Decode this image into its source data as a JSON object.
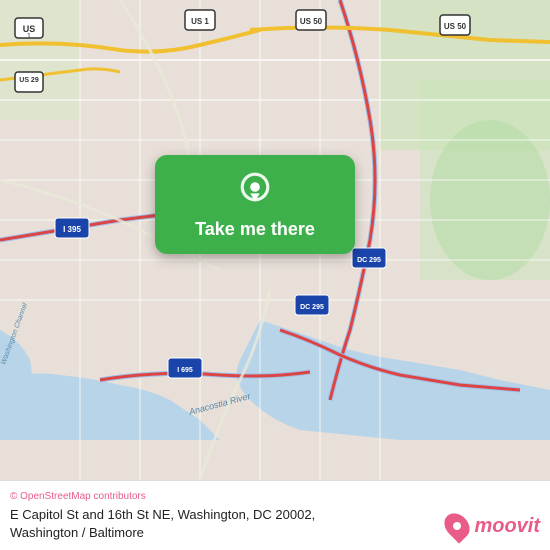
{
  "map": {
    "background_color": "#e8e0d8",
    "popup": {
      "label": "Take me there",
      "background": "#3db04b"
    }
  },
  "footer": {
    "osm_credit": "© OpenStreetMap contributors",
    "location_line1": "E Capitol St and 16th St NE, Washington, DC 20002,",
    "location_line2": "Washington / Baltimore",
    "moovit_text": "moovit"
  }
}
